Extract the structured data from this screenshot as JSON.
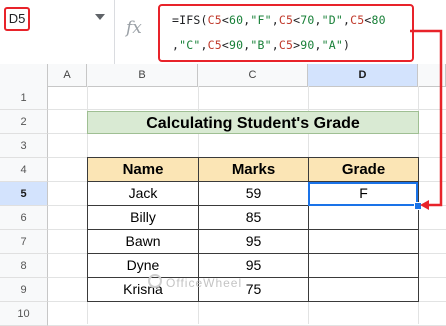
{
  "namebox": {
    "value": "D5"
  },
  "formula": {
    "fx_label": "fx",
    "line1": [
      {
        "t": "=IFS(",
        "c": "plain"
      },
      {
        "t": "C5",
        "c": "ref"
      },
      {
        "t": "<",
        "c": "plain"
      },
      {
        "t": "60",
        "c": "num"
      },
      {
        "t": ",",
        "c": "plain"
      },
      {
        "t": "\"F\"",
        "c": "str"
      },
      {
        "t": ",",
        "c": "plain"
      },
      {
        "t": "C5",
        "c": "ref"
      },
      {
        "t": "<",
        "c": "plain"
      },
      {
        "t": "70",
        "c": "num"
      },
      {
        "t": ",",
        "c": "plain"
      },
      {
        "t": "\"D\"",
        "c": "str"
      },
      {
        "t": ",",
        "c": "plain"
      },
      {
        "t": "C5",
        "c": "ref"
      },
      {
        "t": "<",
        "c": "plain"
      },
      {
        "t": "80",
        "c": "num"
      }
    ],
    "line2": [
      {
        "t": ",",
        "c": "plain"
      },
      {
        "t": "\"C\"",
        "c": "str"
      },
      {
        "t": ",",
        "c": "plain"
      },
      {
        "t": "C5",
        "c": "ref"
      },
      {
        "t": "<",
        "c": "plain"
      },
      {
        "t": "90",
        "c": "num"
      },
      {
        "t": ",",
        "c": "plain"
      },
      {
        "t": "\"B\"",
        "c": "str"
      },
      {
        "t": ",",
        "c": "plain"
      },
      {
        "t": "C5",
        "c": "ref"
      },
      {
        "t": ">",
        "c": "plain"
      },
      {
        "t": "90",
        "c": "num"
      },
      {
        "t": ",",
        "c": "plain"
      },
      {
        "t": "\"A\"",
        "c": "str"
      },
      {
        "t": ")",
        "c": "plain"
      }
    ]
  },
  "columns": [
    "A",
    "B",
    "C",
    "D"
  ],
  "selected_column": "D",
  "rows": [
    "1",
    "2",
    "3",
    "4",
    "5",
    "6",
    "7",
    "8",
    "9",
    "10"
  ],
  "selected_row": "5",
  "title": "Calculating Student's Grade",
  "table": {
    "headers": [
      "Name",
      "Marks",
      "Grade"
    ],
    "rows": [
      [
        "Jack",
        "59",
        "F"
      ],
      [
        "Billy",
        "85",
        ""
      ],
      [
        "Bawn",
        "95",
        ""
      ],
      [
        "Dyne",
        "95",
        ""
      ],
      [
        "Krisna",
        "75",
        ""
      ]
    ]
  },
  "watermark": "OfficeWheel",
  "colors": {
    "accent_red": "#e8232a",
    "selection_blue": "#1a73e8",
    "title_bg": "#d9ead3",
    "header_bg": "#fbe5b5"
  }
}
